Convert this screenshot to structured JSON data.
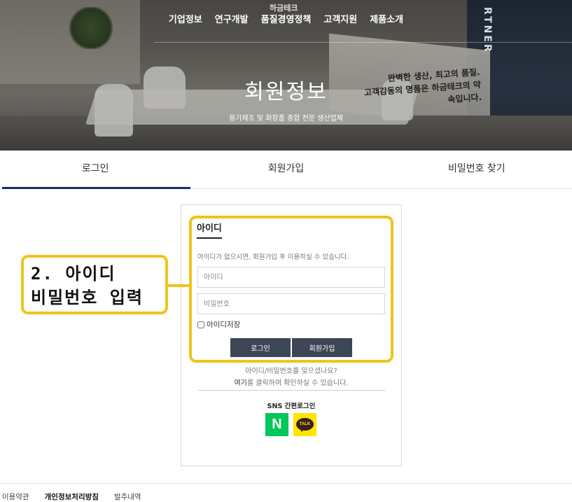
{
  "nav": {
    "items": [
      {
        "label": "기업정보"
      },
      {
        "label": "연구개발"
      },
      {
        "label": "품질경영정책"
      },
      {
        "label": "고객지원"
      },
      {
        "label": "제품소개"
      }
    ]
  },
  "hero": {
    "title": "회원정보",
    "subtitle": "용기제조 및 화장품 종합 전문 생산업체",
    "wall_text_1": "완벽한 생산, 최고의 품질.",
    "wall_text_2": "고객감동의 명품은 하금테크의 약속입니다.",
    "partner_text": "RTNER",
    "sign_text": "하금테크"
  },
  "tabs": [
    {
      "label": "로그인"
    },
    {
      "label": "회원가입"
    },
    {
      "label": "비밀번호 찾기"
    }
  ],
  "login": {
    "heading": "아이디",
    "description": "아이디가 없으시면, 회원가입 후 이용하실 수 있습니다.",
    "id_placeholder": "아이디",
    "password_placeholder": "비밀번호",
    "remember_label": "아이디저장",
    "login_button": "로그인",
    "join_button": "회원가입",
    "find_line1": "아이디/비밀번호를 잊으셨나요?",
    "find_link": "여기",
    "find_line2_rest": "를 클릭하여 확인하실 수 있습니다.",
    "sns_title": "SNS 간편로그인",
    "naver_label": "N",
    "kakao_label": "TALK"
  },
  "annotation": {
    "line1": "2. 아이디",
    "line2": "비밀번호 입력",
    "color": "#f0c419"
  },
  "footer": {
    "items": [
      {
        "label": "이용약관"
      },
      {
        "label": "개인정보처리방침"
      },
      {
        "label": "발주내역"
      }
    ]
  }
}
